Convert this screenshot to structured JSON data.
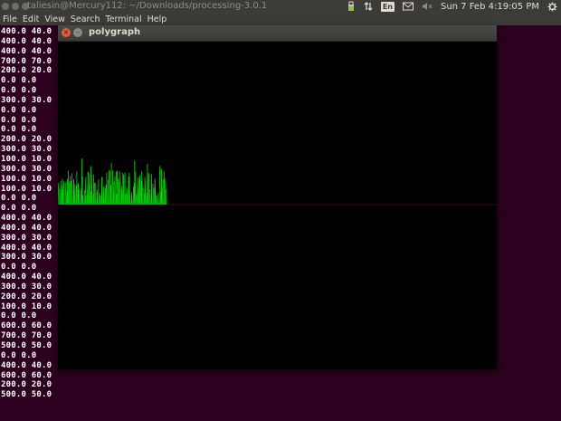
{
  "topbar": {
    "terminal_title": "taliesin@Mercury112: ~/Downloads/processing-3.0.1",
    "keyboard_layout": "En",
    "clock": "Sun 7 Feb  4:19:05 PM",
    "icons": [
      "dropbox-icon",
      "network-icon",
      "keyboard-icon",
      "mail-icon",
      "volume-icon",
      "power-gear-icon"
    ]
  },
  "menu": [
    "File",
    "Edit",
    "View",
    "Search",
    "Terminal",
    "Help"
  ],
  "terminal_lines": [
    "400.0 40.0",
    "400.0 40.0",
    "400.0 40.0",
    "700.0 70.0",
    "200.0 20.0",
    "0.0 0.0",
    "0.0 0.0",
    "300.0 30.0",
    "0.0 0.0",
    "0.0 0.0",
    "0.0 0.0",
    "200.0 20.0",
    "300.0 30.0",
    "100.0 10.0",
    "300.0 30.0",
    "100.0 10.0",
    "100.0 10.0",
    "0.0 0.0",
    "0.0 0.0",
    "400.0 40.0",
    "400.0 40.0",
    "300.0 30.0",
    "400.0 40.0",
    "300.0 30.0",
    "0.0 0.0",
    "400.0 40.0",
    "300.0 30.0",
    "200.0 20.0",
    "100.0 10.0",
    "0.0 0.0",
    "600.0 60.0",
    "700.0 70.0",
    "500.0 50.0",
    "0.0 0.0",
    "400.0 40.0",
    "600.0 60.0",
    "200.0 20.0",
    "500.0 50.0"
  ],
  "polygraph": {
    "title": "polygraph",
    "close_glyph": "×",
    "minimize_glyph": "–",
    "trace_color": "#00e000",
    "baseline_color": "#3a0a20",
    "background": "#000000"
  }
}
